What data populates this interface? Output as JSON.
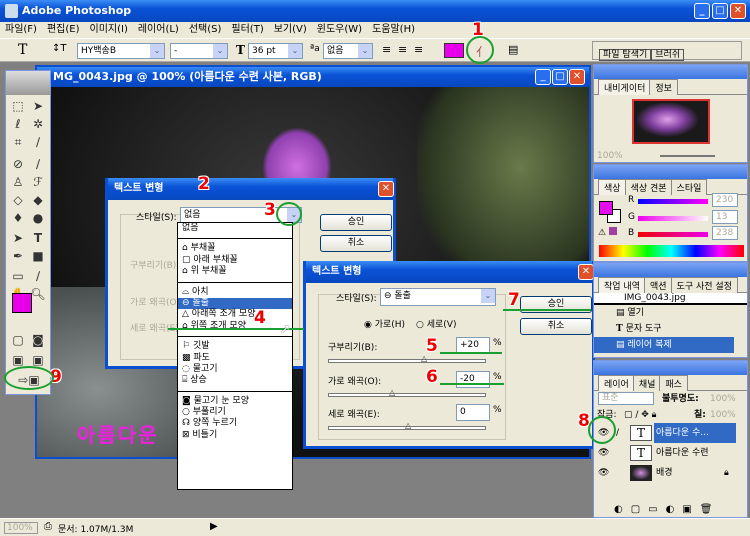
{
  "app": {
    "title": "Adobe Photoshop"
  },
  "menu": [
    "파일(F)",
    "편집(E)",
    "이미지(I)",
    "레이어(L)",
    "선택(S)",
    "필터(T)",
    "보기(V)",
    "윈도우(W)",
    "도움말(H)"
  ],
  "options": {
    "tool": "T",
    "font": "HY백송B",
    "style": "-",
    "size": "36 pt",
    "antialias": "없음",
    "text_color": "#e800e8"
  },
  "palette_well_tabs": [
    "파일 탐색기",
    "브러쉬"
  ],
  "document": {
    "title": "MG_0043.jpg @ 100% (아름다운 수련 사본, RGB)",
    "canvas_text": "아름다운"
  },
  "dialog_back": {
    "title": "텍스트 변형",
    "style_label": "스타일(S):",
    "style_value": "없음",
    "ok": "승인",
    "cancel": "취소",
    "bend": "구부리기(B):",
    "hdist": "가로 왜곡(O):",
    "vdist": "세로 왜곡(E):"
  },
  "style_dropdown": {
    "groups": [
      [
        "없음"
      ],
      [
        "부채꼴",
        "아래 부채꼴",
        "위 부채꼴"
      ],
      [
        "아치",
        "돌출",
        "아래쪽 조개 모양",
        "위쪽 조개 모양"
      ],
      [
        "깃발",
        "파도",
        "물고기",
        "상승"
      ],
      [
        "물고기 눈 모양",
        "부풀리기",
        "양쪽 누르기",
        "비틀기"
      ]
    ],
    "selected": "돌출"
  },
  "dialog_front": {
    "title": "텍스트 변형",
    "style_label": "스타일(S):",
    "style_value": "돌출",
    "horizontal": "가로(H)",
    "vertical": "세로(V)",
    "orientation": "horizontal",
    "ok": "승인",
    "cancel": "취소",
    "bend_label": "구부리기(B):",
    "bend": "+20",
    "hdist_label": "가로 왜곡(O):",
    "hdist": "-20",
    "vdist_label": "세로 왜곡(E):",
    "vdist": "0",
    "pct": "%"
  },
  "annotations": [
    "1",
    "2",
    "3",
    "4",
    "5",
    "6",
    "7",
    "8",
    "9"
  ],
  "navigator": {
    "tabs": [
      "내비게이터",
      "정보"
    ],
    "zoom": "100%"
  },
  "color": {
    "tabs": [
      "색상",
      "색상 견본",
      "스타일"
    ],
    "R": "230",
    "G": "13",
    "B": "238",
    "fg": "#e60dee",
    "bg": "#ffffff"
  },
  "history": {
    "tabs": [
      "작업 내역",
      "액션",
      "도구 사전 설정"
    ],
    "snapshot": "IMG_0043.jpg",
    "items": [
      "열기",
      "문자 도구",
      "레이어 복제"
    ],
    "selected": "레이어 복제"
  },
  "layers": {
    "tabs": [
      "레이어",
      "채널",
      "패스"
    ],
    "blend": "표준",
    "opacity_label": "불투명도:",
    "opacity": "100%",
    "lock_label": "잠금:",
    "fill_label": "칠:",
    "fill": "100%",
    "items": [
      {
        "name": "아름다운 수...",
        "type": "text",
        "selected": true
      },
      {
        "name": "아름다운 수련",
        "type": "text",
        "selected": false
      },
      {
        "name": "배경",
        "type": "image",
        "selected": false,
        "locked": true
      }
    ]
  },
  "status": {
    "zoom": "100%",
    "doc": "문서: 1.07M/1.3M"
  }
}
